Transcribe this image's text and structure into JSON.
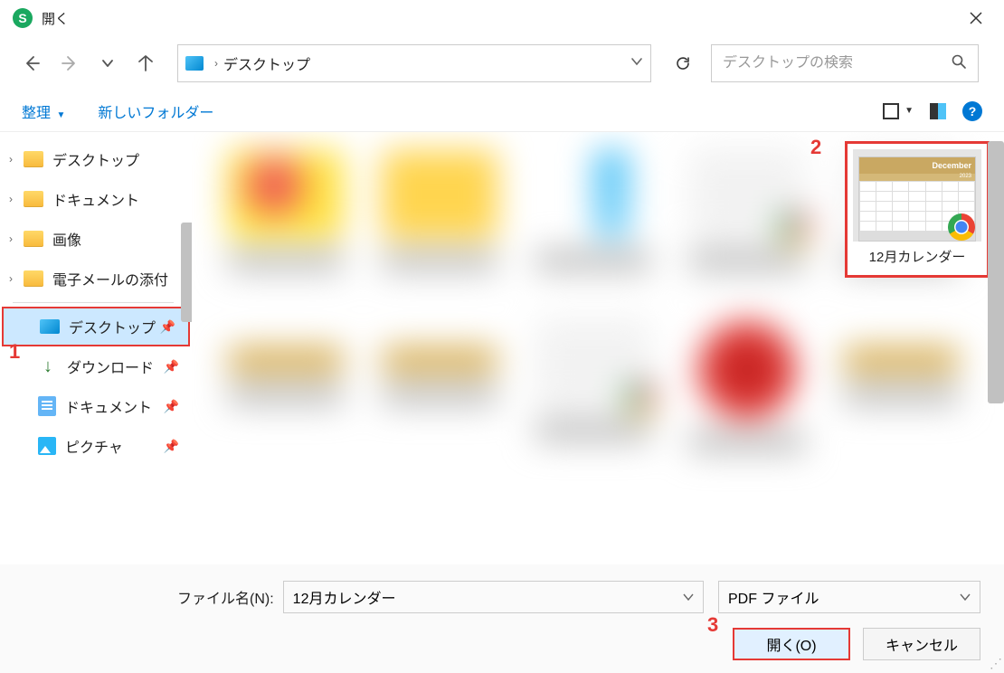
{
  "title": "開く",
  "app_icon_letter": "S",
  "path": {
    "location": "デスクトップ"
  },
  "search": {
    "placeholder": "デスクトップの検索"
  },
  "toolbar": {
    "organize": "整理",
    "new_folder": "新しいフォルダー"
  },
  "sidebar": {
    "tree": [
      {
        "label": "デスクトップ"
      },
      {
        "label": "ドキュメント"
      },
      {
        "label": "画像"
      },
      {
        "label": "電子メールの添付"
      }
    ],
    "quick": [
      {
        "label": "デスクトップ",
        "selected": true
      },
      {
        "label": "ダウンロード"
      },
      {
        "label": "ドキュメント"
      },
      {
        "label": "ピクチャ"
      }
    ]
  },
  "selected_file": {
    "label": "12月カレンダー",
    "thumb_header": "December",
    "thumb_sub": "2023"
  },
  "bottom": {
    "filename_label": "ファイル名(N):",
    "filename_value": "12月カレンダー",
    "filetype_value": "PDF ファイル",
    "open_btn": "開く(O)",
    "cancel_btn": "キャンセル"
  },
  "callouts": {
    "c1": "1",
    "c2": "2",
    "c3": "3"
  }
}
